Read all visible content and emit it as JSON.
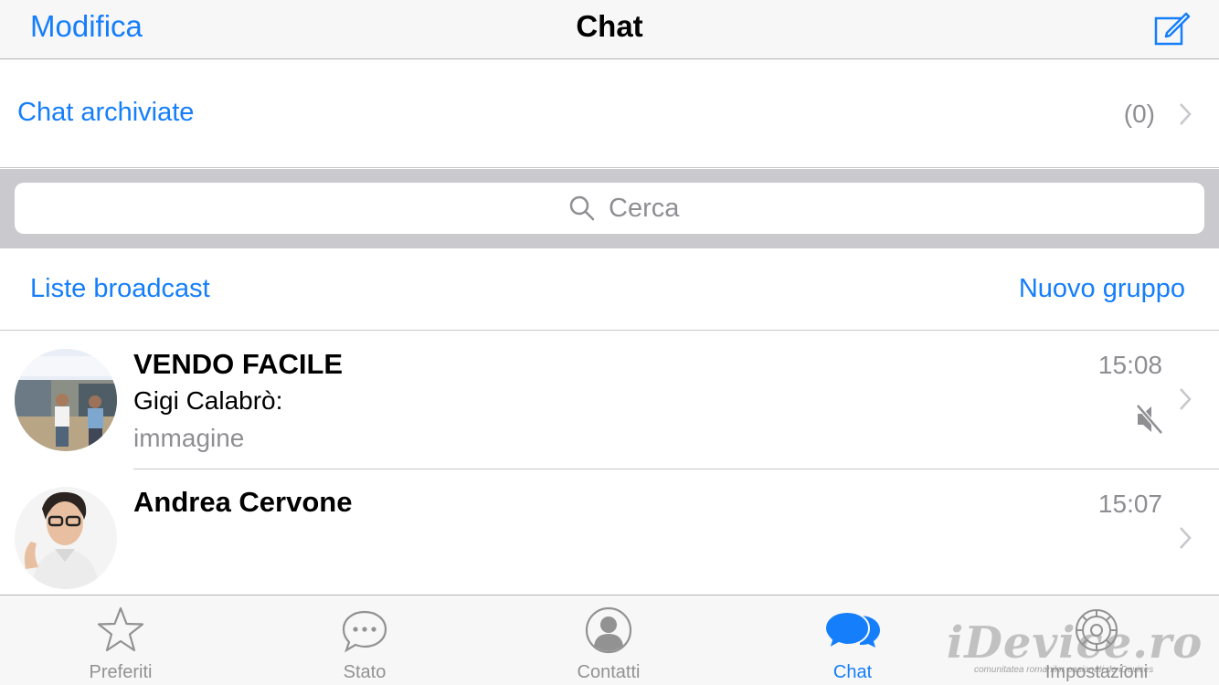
{
  "navbar": {
    "edit_label": "Modifica",
    "title": "Chat",
    "compose_icon": "compose-icon"
  },
  "archived": {
    "label": "Chat archiviate",
    "count": "(0)"
  },
  "search": {
    "placeholder": "Cerca"
  },
  "links": {
    "broadcast": "Liste broadcast",
    "new_group": "Nuovo gruppo"
  },
  "chats": [
    {
      "name": "VENDO FACILE",
      "time": "15:08",
      "sender": "Gigi Calabrò:",
      "preview": "immagine",
      "muted": true,
      "avatar": "group-photo-avatar"
    },
    {
      "name": "Andrea Cervone",
      "time": "15:07",
      "sender": "",
      "preview": "",
      "muted": false,
      "avatar": "person-photo-avatar"
    }
  ],
  "tabs": [
    {
      "label": "Preferiti",
      "icon": "star-icon",
      "active": false
    },
    {
      "label": "Stato",
      "icon": "speech-bubble-icon",
      "active": false
    },
    {
      "label": "Contatti",
      "icon": "contact-silhouette-icon",
      "active": false
    },
    {
      "label": "Chat",
      "icon": "chat-bubbles-icon",
      "active": true
    },
    {
      "label": "Impostazioni",
      "icon": "gear-icon",
      "active": false
    }
  ],
  "watermark": {
    "main": "iDevice.ro",
    "sub": "comunitatea romanilor pasionati de iDevices"
  },
  "colors": {
    "accent": "#157efb",
    "secondary_text": "#8e8e93",
    "bar_background": "#f7f7f7",
    "search_background": "#c9c9ce"
  }
}
